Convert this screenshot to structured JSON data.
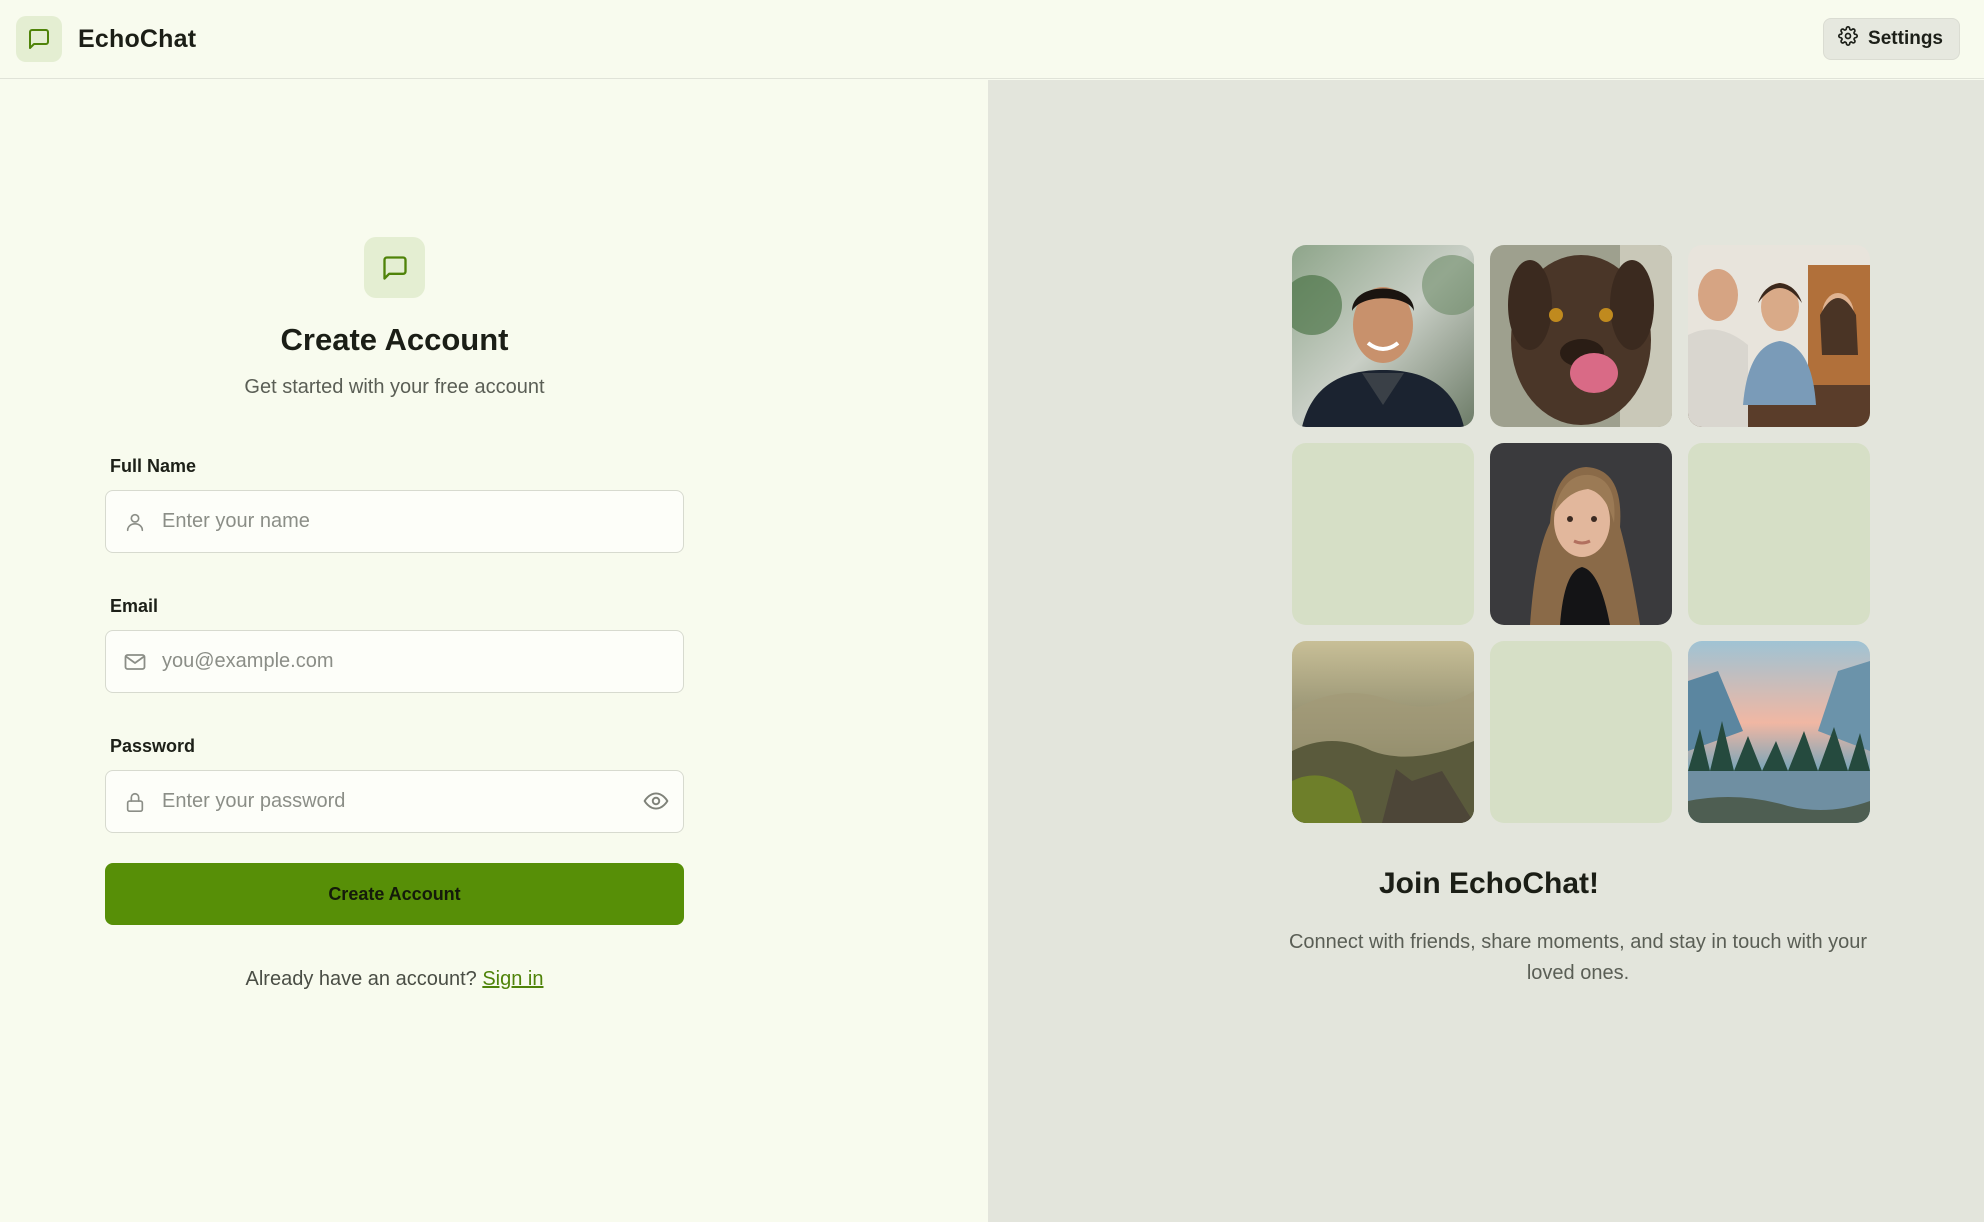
{
  "app": {
    "name": "EchoChat"
  },
  "header": {
    "settings_label": "Settings"
  },
  "form": {
    "title": "Create Account",
    "subtitle": "Get started with your free account",
    "fields": {
      "name": {
        "label": "Full Name",
        "placeholder": "Enter your name",
        "value": ""
      },
      "email": {
        "label": "Email",
        "placeholder": "you@example.com",
        "value": ""
      },
      "password": {
        "label": "Password",
        "placeholder": "Enter your password",
        "value": ""
      }
    },
    "submit_label": "Create Account",
    "signin_prompt": "Already have an account?",
    "signin_link": "Sign in"
  },
  "showcase": {
    "title": "Join EchoChat!",
    "text": "Connect with friends, share moments, and stay in touch with your loved ones.",
    "tiles": [
      {
        "type": "photo",
        "subject": "smiling-man-portrait"
      },
      {
        "type": "photo",
        "subject": "dog-closeup"
      },
      {
        "type": "photo",
        "subject": "friends-at-table"
      },
      {
        "type": "placeholder"
      },
      {
        "type": "photo",
        "subject": "woman-portrait"
      },
      {
        "type": "placeholder"
      },
      {
        "type": "photo",
        "subject": "mountain-landscape"
      },
      {
        "type": "placeholder"
      },
      {
        "type": "photo",
        "subject": "forest-river-sunset"
      }
    ]
  },
  "colors": {
    "accent": "#578f07",
    "accent_soft": "#e4eed2",
    "left_bg": "#f8fbee",
    "right_bg": "#e3e5dc",
    "placeholder_tile": "#d6dfc6"
  },
  "icons": {
    "brand": "chat-bubble-icon",
    "settings": "gear-icon",
    "name": "user-icon",
    "email": "mail-icon",
    "password": "lock-icon",
    "toggle": "eye-icon"
  }
}
